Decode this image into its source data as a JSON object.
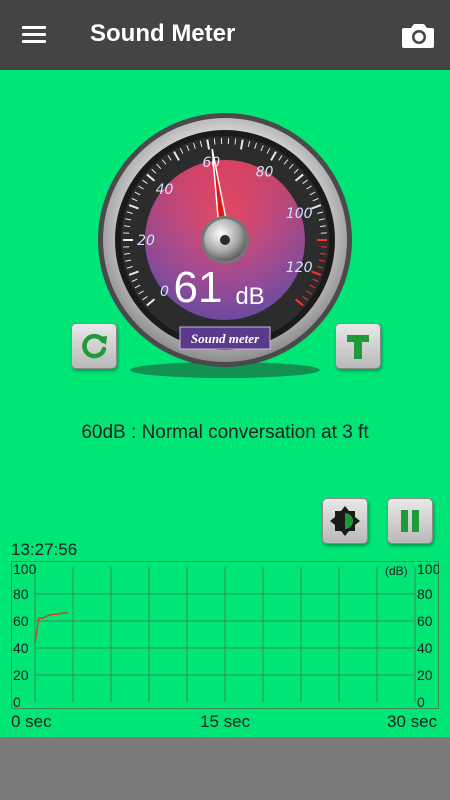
{
  "app": {
    "title": "Sound Meter"
  },
  "icons": {
    "menu": "hamburger-menu-icon",
    "camera": "camera-icon",
    "reset": "refresh-icon",
    "typeT": "letter-t-icon",
    "brightness": "contrast-icon",
    "pause": "pause-icon"
  },
  "gauge": {
    "value_db": 61,
    "value_label": "61",
    "unit": "dB",
    "brand_label": "Sound meter",
    "scale_labels": [
      "0",
      "20",
      "40",
      "60",
      "80",
      "100",
      "120"
    ]
  },
  "description": "60dB : Normal conversation at 3 ft",
  "graph": {
    "time": "13:27:56",
    "unit_label": "(dB)",
    "y_labels": [
      "100",
      "80",
      "60",
      "40",
      "20",
      "0"
    ],
    "x_labels": [
      "0 sec",
      "15 sec",
      "30 sec"
    ]
  },
  "colors": {
    "background": "#00e676",
    "toolbar": "#444444",
    "needle": "#e01818",
    "graph_line": "#c04a2a"
  },
  "chart_data": {
    "type": "line",
    "x": [
      0.0,
      0.3,
      0.6,
      1.0,
      1.4,
      1.8,
      2.2,
      2.6
    ],
    "y": [
      44,
      62,
      62,
      64,
      65,
      65,
      66,
      66
    ],
    "xlabel": "",
    "ylabel": "",
    "xlim": [
      0,
      30
    ],
    "ylim": [
      0,
      100
    ],
    "grid": true
  }
}
